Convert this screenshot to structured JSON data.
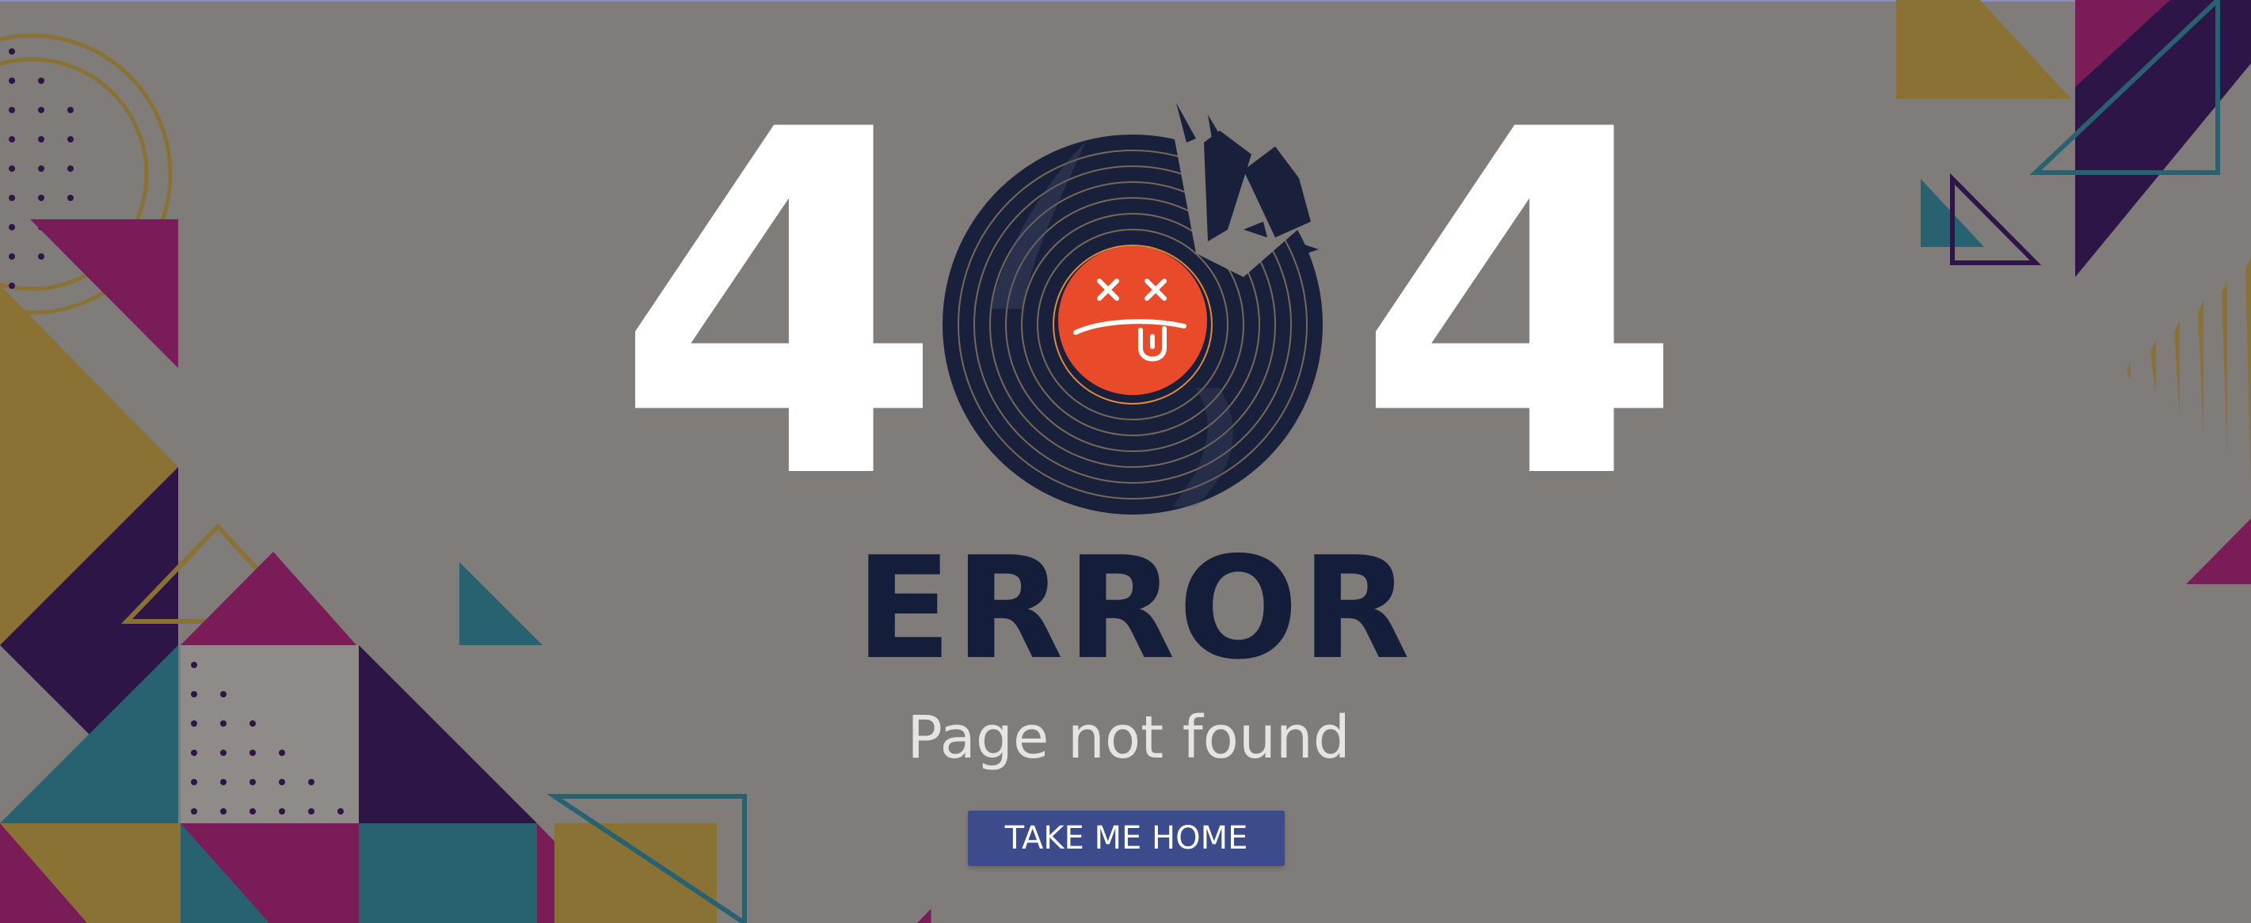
{
  "hero": {
    "digit_left": "4",
    "digit_right": "4"
  },
  "error": {
    "heading": "ERROR",
    "message": "Page not found"
  },
  "actions": {
    "home_button_label": "TAKE ME HOME"
  },
  "icons": {
    "record": "broken-vinyl-record-icon",
    "face": "dizzy-face-icon"
  },
  "colors": {
    "background": "#807c79",
    "digits": "#ffffff",
    "heading": "#141d3a",
    "subtitle": "#e6e4e2",
    "button": "#3b4b8c",
    "record": "#18203b",
    "record_label": "#e94b2a",
    "ochre": "#8a7234",
    "magenta": "#7a1c57",
    "purple": "#2e1548",
    "teal": "#286270"
  }
}
